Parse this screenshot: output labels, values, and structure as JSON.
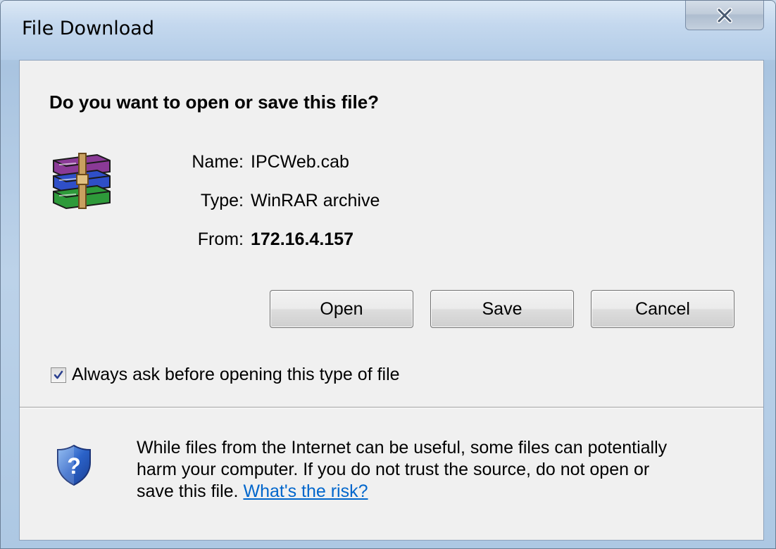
{
  "window": {
    "title": "File Download"
  },
  "dialog": {
    "question": "Do you want to open or save this file?",
    "file_icon": "winrar-archive-icon",
    "fields": [
      {
        "label": "Name:",
        "value": "IPCWeb.cab"
      },
      {
        "label": "Type:",
        "value": "WinRAR archive"
      },
      {
        "label": "From:",
        "value": "172.16.4.157"
      }
    ],
    "buttons": {
      "open": "Open",
      "save": "Save",
      "cancel": "Cancel"
    },
    "always_ask": {
      "label": "Always ask before opening this type of file",
      "checked": true
    },
    "warning": {
      "icon": "shield-question-icon",
      "line1": "While files from the Internet can be useful, some files can potentially",
      "line2": "harm your computer. If you do not trust the source, do not open or",
      "line3": "save this file.",
      "link": "What's the risk?"
    }
  },
  "colors": {
    "link": "#0066cc",
    "dialog_bg": "#f0f0f0",
    "titlebar": "#b3cce7"
  }
}
